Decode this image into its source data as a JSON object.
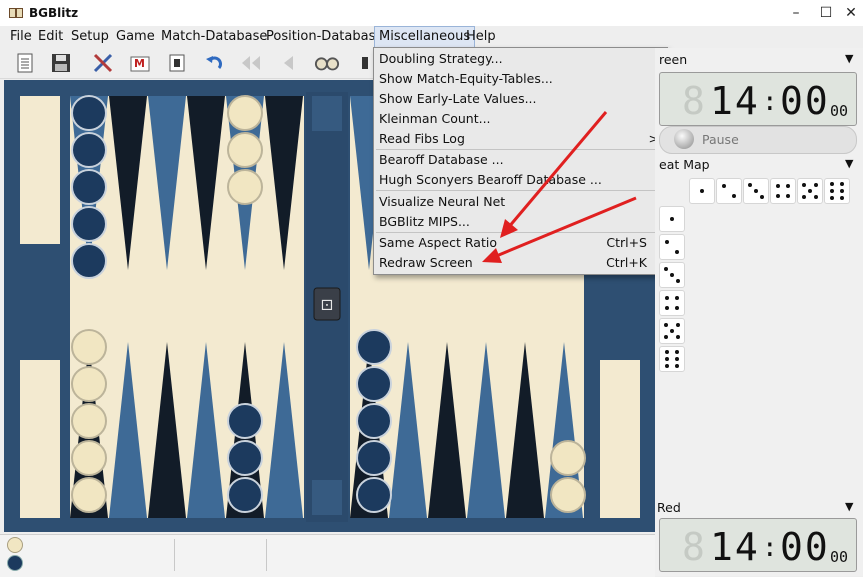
{
  "window": {
    "title": "BGBlitz",
    "minimize_glyph": "–",
    "maximize_glyph": "☐",
    "close_glyph": "✕"
  },
  "menubar": [
    {
      "label": "File"
    },
    {
      "label": "Edit"
    },
    {
      "label": "Setup"
    },
    {
      "label": "Game"
    },
    {
      "label": "Match-Database"
    },
    {
      "label": "Position-Database"
    },
    {
      "label": "Miscellaneous",
      "open": true
    },
    {
      "label": "Help"
    }
  ],
  "toolbar_icons": [
    "document-icon",
    "save-icon",
    "settings-tools-icon",
    "mail-icon",
    "print-icon",
    "undo-icon",
    "fast-back-icon",
    "back-icon",
    "glasses-icon",
    "more-icon"
  ],
  "misc_menu": {
    "items": [
      {
        "label": "Doubling Strategy..."
      },
      {
        "label": "Show Match-Equity-Tables..."
      },
      {
        "label": "Show Early-Late Values..."
      },
      {
        "label": "Kleinman Count..."
      },
      {
        "label": "Read Fibs Log",
        "submenu_arrow": ">"
      },
      {
        "label": "Bearoff Database ..."
      },
      {
        "label": "Hugh Sconyers Bearoff Database ..."
      },
      {
        "label": "Visualize Neural Net"
      },
      {
        "label": "BGBlitz MIPS..."
      },
      {
        "label": "Same Aspect Ratio",
        "shortcut": "Ctrl+S"
      },
      {
        "label": "Redraw Screen",
        "shortcut": "Ctrl+K"
      }
    ]
  },
  "right_panel": {
    "top_section_title": "reen",
    "top_clock": {
      "digits_main_left": "14",
      "separator": ":",
      "digits_main_right": "00",
      "digits_small": "00"
    },
    "pause_button": {
      "label": "Pause"
    },
    "heat_map_title": "eat Map",
    "bottom_section_title": "Red",
    "bottom_clock": {
      "digits_main_left": "14",
      "separator": ":",
      "digits_main_right": "00",
      "digits_small": "00"
    }
  },
  "board": {
    "cube_label": "⚀",
    "white_checker_color": "#f1e6c2",
    "blue_checker_color": "#1c3a5e",
    "point_dark": "#121c28",
    "point_blue": "#3e6a96",
    "felt_color": "#f3ead0",
    "frame_color": "#2e4f72"
  },
  "statusbar": {
    "player_white_icon": "white-checker-icon",
    "player_blue_icon": "blue-checker-icon"
  }
}
